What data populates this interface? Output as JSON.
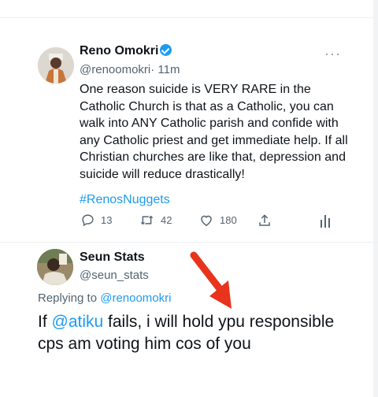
{
  "tweet": {
    "author_name": "Reno Omokri",
    "handle": "@renoomokri",
    "time": "· 11m",
    "text": "One reason suicide is VERY RARE in the Catholic Church is that as a Catholic, you can walk into ANY Catholic parish and confide with any Catholic priest and get immediate help. If all Christian churches are like that, depression and suicide will reduce drastically!",
    "hashtag": "#RenosNuggets",
    "replies": "13",
    "retweets": "42",
    "likes": "180",
    "more_icon": "more-icon"
  },
  "reply": {
    "author_name": "Seun Stats",
    "handle": "@seun_stats",
    "replying_prefix": "Replying to ",
    "replying_to": "@renoomokri",
    "text_before": "If ",
    "mention": "@atiku",
    "text_after": " fails, i will hold ypu responsible cps am voting him cos of you"
  },
  "colors": {
    "accent": "#1d9bf0",
    "arrow": "#e8341c",
    "muted": "#536471"
  }
}
